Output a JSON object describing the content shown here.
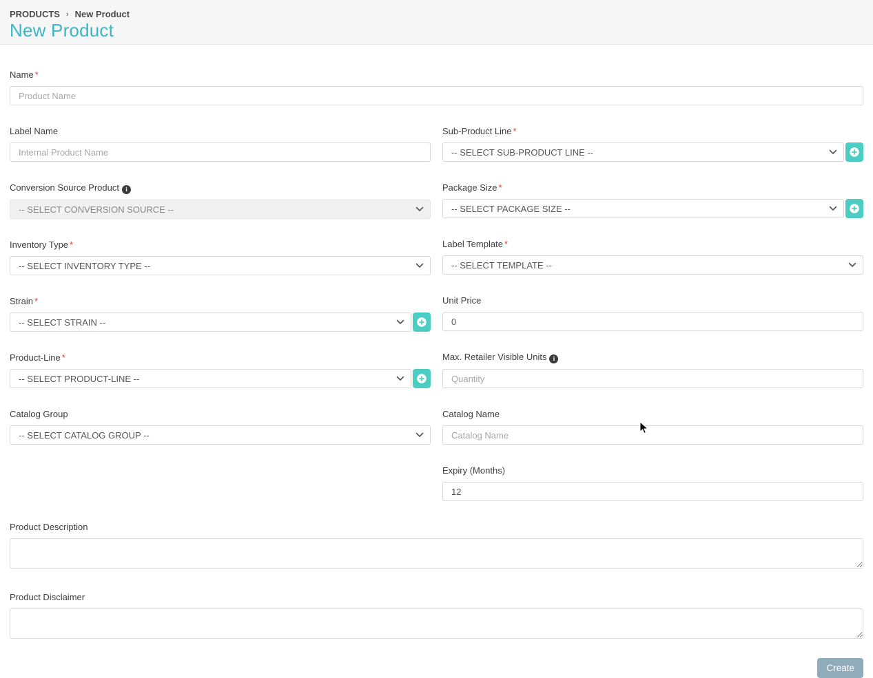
{
  "colors": {
    "accent_teal": "#4ccdc4",
    "title_teal": "#3ab7c2",
    "create_button": "#90abba",
    "required_red": "#e03e3e",
    "header_bg": "#f6f6f6",
    "input_border": "#d9d9d9",
    "disabled_bg": "#ececec"
  },
  "header": {
    "breadcrumb": {
      "root": "PRODUCTS",
      "separator": "›",
      "current": "New Product"
    },
    "title": "New Product"
  },
  "ui": {
    "required_marker": "*",
    "info_icon_glyph": "i",
    "create_label": "Create"
  },
  "fields": {
    "name": {
      "label": "Name",
      "placeholder": "Product Name"
    },
    "label_name": {
      "label": "Label Name",
      "placeholder": "Internal Product Name"
    },
    "sub_product_line": {
      "label": "Sub-Product Line",
      "selected": "-- SELECT SUB-PRODUCT LINE --"
    },
    "conversion_source": {
      "label": "Conversion Source Product",
      "selected": "-- SELECT CONVERSION SOURCE --"
    },
    "package_size": {
      "label": "Package Size",
      "selected": "-- SELECT PACKAGE SIZE --"
    },
    "inventory_type": {
      "label": "Inventory Type",
      "selected": "-- SELECT INVENTORY TYPE --"
    },
    "label_template": {
      "label": "Label Template",
      "selected": "-- SELECT TEMPLATE --"
    },
    "strain": {
      "label": "Strain",
      "selected": "-- SELECT STRAIN --"
    },
    "unit_price": {
      "label": "Unit Price",
      "value": "0"
    },
    "product_line": {
      "label": "Product-Line",
      "selected": "-- SELECT PRODUCT-LINE --"
    },
    "max_retailer_visible_units": {
      "label": "Max. Retailer Visible Units",
      "placeholder": "Quantity"
    },
    "catalog_group": {
      "label": "Catalog Group",
      "selected": "-- SELECT CATALOG GROUP --"
    },
    "catalog_name": {
      "label": "Catalog Name",
      "placeholder": "Catalog Name"
    },
    "expiry_months": {
      "label": "Expiry (Months)",
      "value": "12"
    },
    "product_description": {
      "label": "Product Description"
    },
    "product_disclaimer": {
      "label": "Product Disclaimer"
    }
  }
}
